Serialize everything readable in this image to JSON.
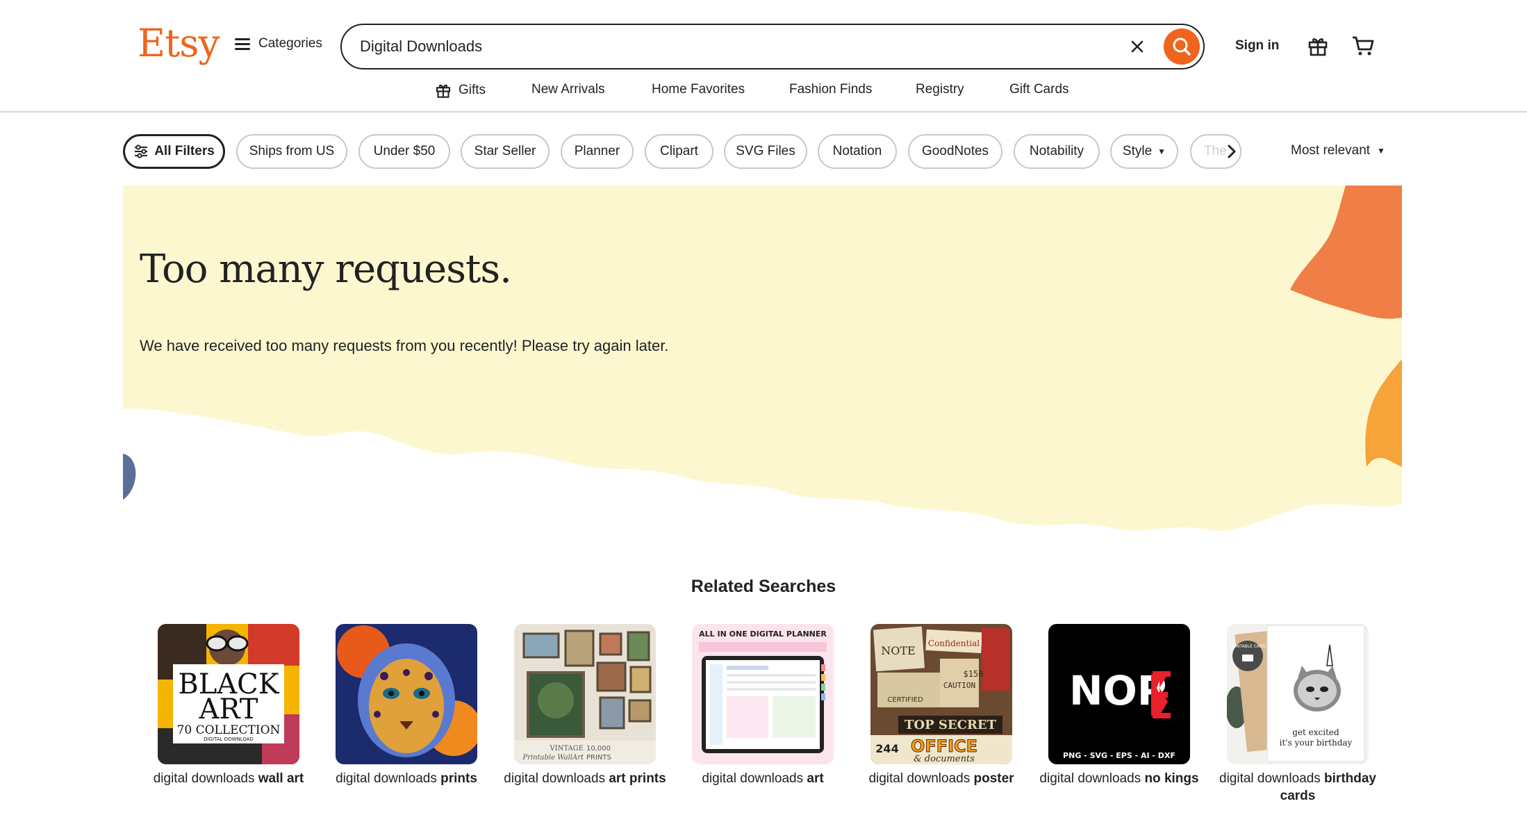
{
  "header": {
    "logo": "Etsy",
    "categories_label": "Categories",
    "search_value": "Digital Downloads",
    "sign_in": "Sign in"
  },
  "subnav": [
    "Gifts",
    "New Arrivals",
    "Home Favorites",
    "Fashion Finds",
    "Registry",
    "Gift Cards"
  ],
  "filters": {
    "all": "All Filters",
    "chips": [
      "Ships from US",
      "Under $50",
      "Star Seller",
      "Planner",
      "Clipart",
      "SVG Files",
      "Notation",
      "GoodNotes",
      "Notability"
    ],
    "style": "Style",
    "faded": "The",
    "sort": "Most relevant"
  },
  "error": {
    "title": "Too many requests.",
    "message": "We have received too many requests from you recently! Please try again later."
  },
  "related": {
    "title": "Related Searches",
    "items": [
      {
        "prefix": "digital downloads",
        "bold": "wall art",
        "image": "black art collection"
      },
      {
        "prefix": "digital downloads",
        "bold": "prints",
        "image": "psychedelic leopard"
      },
      {
        "prefix": "digital downloads",
        "bold": "art prints",
        "image": "vintage gallery wall"
      },
      {
        "prefix": "digital downloads",
        "bold": "art",
        "image": "digital planner tablet"
      },
      {
        "prefix": "digital downloads",
        "bold": "poster",
        "image": "office documents ephemera"
      },
      {
        "prefix": "digital downloads",
        "bold": "no kings",
        "image": "NOPE svg"
      },
      {
        "prefix": "digital downloads",
        "bold": "birthday cards",
        "image": "cat birthday card"
      }
    ],
    "thumb_text": {
      "black_art_1": "BLACK",
      "black_art_2": "ART",
      "black_art_3": "70 COLLECTION",
      "black_art_4": "DIGITAL DOWNLOAD",
      "vintage_1": "VINTAGE",
      "vintage_2": "10,000",
      "vintage_3": "Printable WallArt",
      "vintage_4": "PRINTS",
      "planner_1": "ALL IN ONE DIGITAL PLANNER",
      "office_1": "NOTE",
      "office_2": "Confidential",
      "office_3": "TOP SECRET",
      "office_4": "244",
      "office_5": "OFFICE",
      "office_6": "& documents",
      "office_7": "CERTIFIED",
      "office_8": "CAUTION",
      "office_9": "$150",
      "nope_1": "NOP",
      "nope_2": "PNG - SVG - EPS - AI - DXF",
      "card_1": "get excited",
      "card_2": "it's your birthday",
      "card_3": "PRINTABLE CARD"
    }
  },
  "colors": {
    "brand": "#f1641e",
    "banner_bg": "#fdf7d0",
    "text": "#222222"
  }
}
